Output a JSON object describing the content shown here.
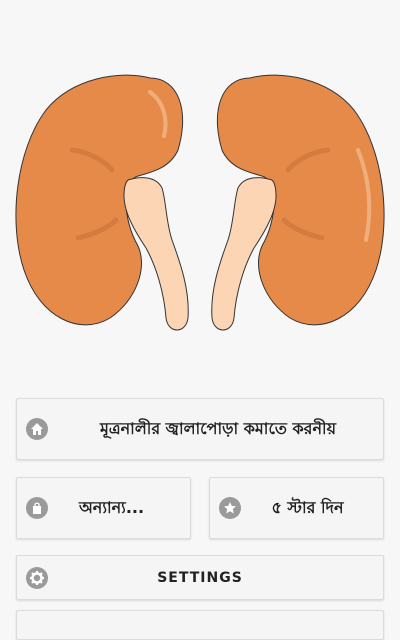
{
  "hero": {
    "image": "kidneys-illustration"
  },
  "menu": {
    "main_button": {
      "label": "মূত্রনালীর জ্বালাপোড়া কমাতে করনীয়",
      "icon": "home-icon"
    },
    "more_button": {
      "label": "অন্যান্য...",
      "icon": "shopping-bag-icon"
    },
    "rate_button": {
      "label": "৫ স্টার দিন",
      "icon": "star-icon"
    },
    "settings_button": {
      "label": "SETTINGS",
      "icon": "gear-icon"
    }
  },
  "colors": {
    "kidney": "#e68a4a",
    "ureter": "#fcd5b5",
    "background": "#f7f7f7",
    "icon": "#9a9a9a"
  }
}
